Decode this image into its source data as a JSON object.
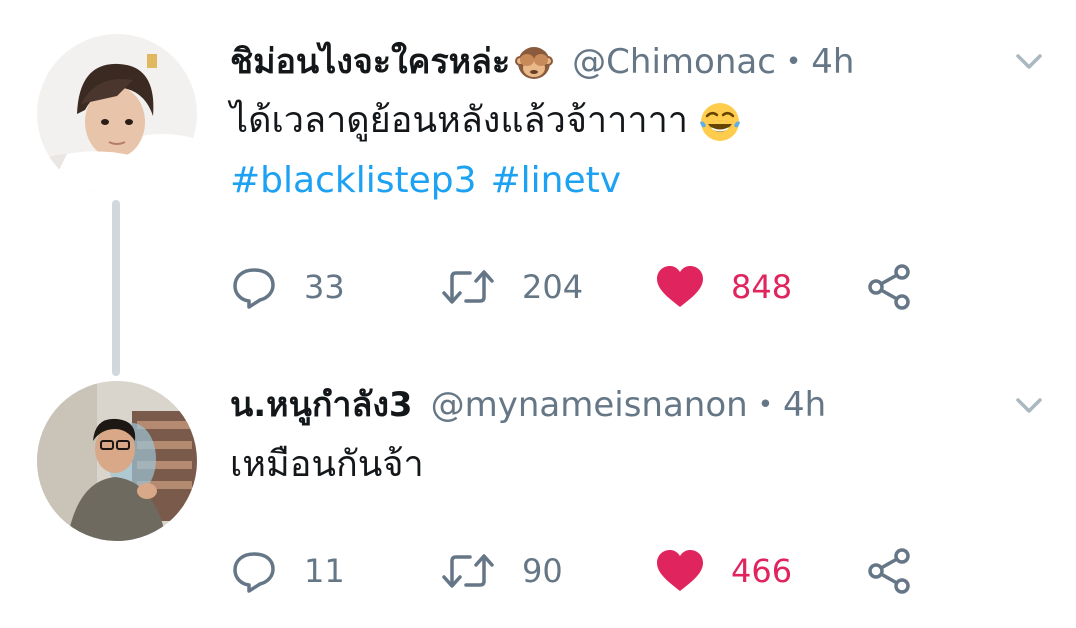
{
  "thread": [
    {
      "display_name": "ชิม่อนไงจะใครหล่ะ",
      "name_emoji": "see-no-evil-monkey",
      "handle": "@Chimonac",
      "separator": "•",
      "time": "4h",
      "text": "ได้เวลาดูย้อนหลังแล้วจ้าาาาา",
      "text_emoji": "face-with-tears-of-joy",
      "hashtags": [
        "#blacklistep3",
        "#linetv"
      ],
      "replies": "33",
      "retweets": "204",
      "likes": "848",
      "liked": true
    },
    {
      "display_name": "น.หนูกำลัง3",
      "handle": "@mynameisnanon",
      "separator": "•",
      "time": "4h",
      "text": "เหมือนกันจ้า",
      "replies": "11",
      "retweets": "90",
      "likes": "466",
      "liked": true
    }
  ],
  "colors": {
    "hashtag": "#1da1f2",
    "like": "#e0245e",
    "secondary": "#657786",
    "thread_line": "#d0d8de"
  },
  "icons": [
    "reply-icon",
    "retweet-icon",
    "heart-icon",
    "share-icon",
    "chevron-down-icon"
  ]
}
